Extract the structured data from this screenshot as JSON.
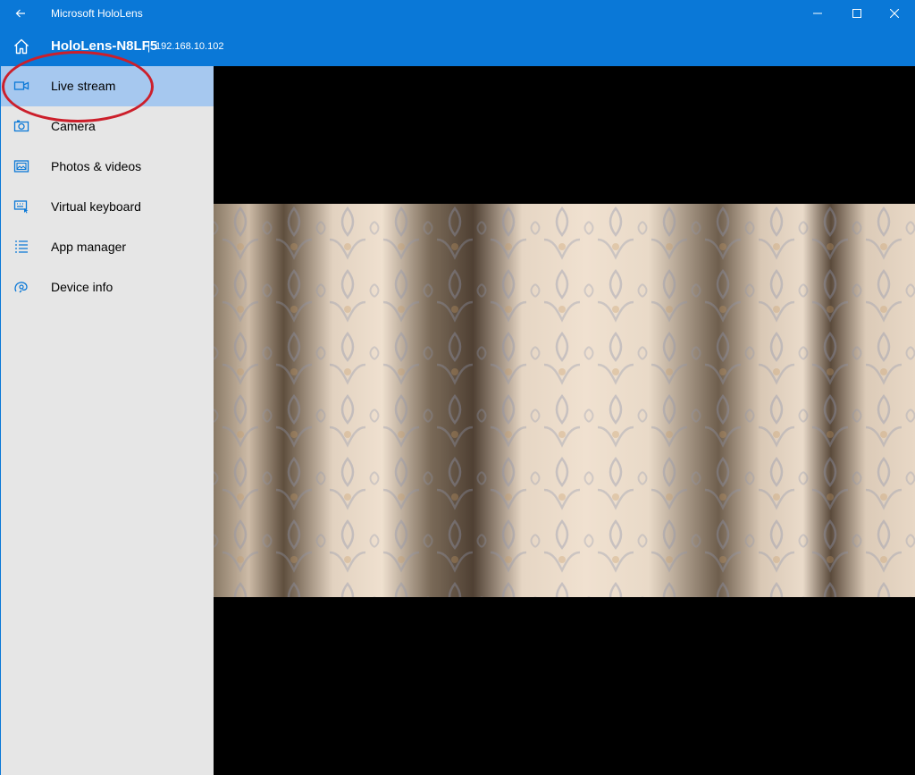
{
  "window": {
    "title": "Microsoft HoloLens",
    "back_icon": "back-arrow-icon",
    "controls": [
      "minimize-icon",
      "maximize-icon",
      "close-icon"
    ]
  },
  "header": {
    "device_name": "HoloLens-N8LF5",
    "separator": "|",
    "device_ip": "192.168.10.102",
    "home_icon": "home-icon"
  },
  "sidebar": {
    "items": [
      {
        "label": "Live stream",
        "icon": "video-camera-icon",
        "selected": true
      },
      {
        "label": "Camera",
        "icon": "camera-icon",
        "selected": false
      },
      {
        "label": "Photos & videos",
        "icon": "photos-icon",
        "selected": false
      },
      {
        "label": "Virtual keyboard",
        "icon": "keyboard-icon",
        "selected": false
      },
      {
        "label": "App manager",
        "icon": "list-icon",
        "selected": false
      },
      {
        "label": "Device info",
        "icon": "device-info-icon",
        "selected": false
      }
    ]
  },
  "colors": {
    "accent": "#0a78d7",
    "sidebar_bg": "#e6e6e6",
    "selected_bg": "#a6c8ef",
    "annotation": "#cc1f2b",
    "stream_bg": "#000000"
  }
}
